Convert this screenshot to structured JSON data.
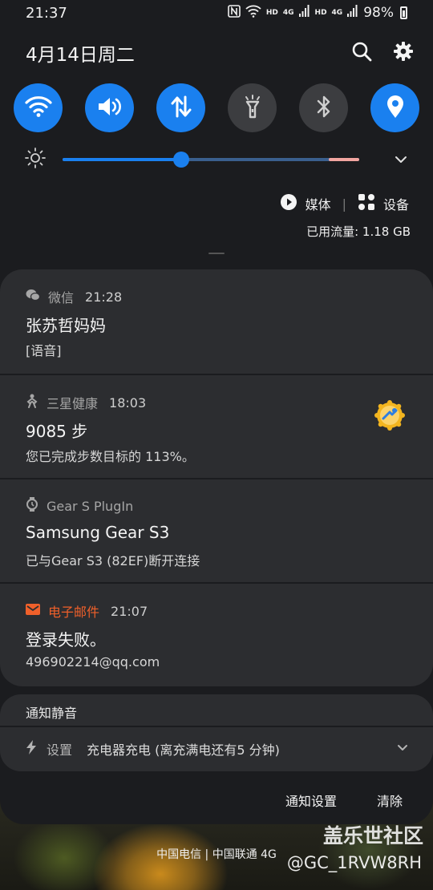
{
  "status_bar": {
    "time": "21:37",
    "net1": "HD",
    "net1_gen": "4G",
    "net2": "HD",
    "net2_gen": "4G",
    "battery": "98%"
  },
  "header": {
    "date": "4月14日周二"
  },
  "quick_toggles": [
    {
      "icon": "wifi-icon",
      "on": true
    },
    {
      "icon": "sound-icon",
      "on": true
    },
    {
      "icon": "mobile-data-icon",
      "on": true
    },
    {
      "icon": "flashlight-icon",
      "on": false
    },
    {
      "icon": "bluetooth-icon",
      "on": false
    },
    {
      "icon": "location-icon",
      "on": true
    }
  ],
  "brightness": {
    "level": 0.4
  },
  "media_row": {
    "media_label": "媒体",
    "device_label": "设备",
    "separator": "|"
  },
  "data_usage": "已用流量: 1.18 GB",
  "notifications": [
    {
      "app": "微信",
      "time": "21:28",
      "title": "张苏哲妈妈",
      "body": "[语音]",
      "icon": "wechat-icon",
      "color": "#a6a6a6"
    },
    {
      "app": "三星健康",
      "time": "18:03",
      "title": "9085 步",
      "body": "您已完成步数目标的 113%。",
      "icon": "samsung-health-icon",
      "color": "#a6a6a6"
    },
    {
      "app": "Gear S PlugIn",
      "time": "",
      "title": "Samsung Gear S3",
      "body": "已与Gear S3 (82EF)断开连接",
      "icon": "watch-icon",
      "color": "#a6a6a6"
    },
    {
      "app": "电子邮件",
      "time": "21:07",
      "title": "登录失败。",
      "body": "496902214@qq.com",
      "icon": "email-icon",
      "color": "#f0602a"
    }
  ],
  "silent": {
    "title": "通知静音",
    "app": "设置",
    "message": "充电器充电 (离充满电还有5 分钟)"
  },
  "bottom": {
    "notif_settings": "通知设置",
    "clear": "清除"
  },
  "carrier": "中国电信 | 中国联通 4G",
  "watermark": "盖乐世社区",
  "watermark_handle": "@GC_1RVW8RH"
}
